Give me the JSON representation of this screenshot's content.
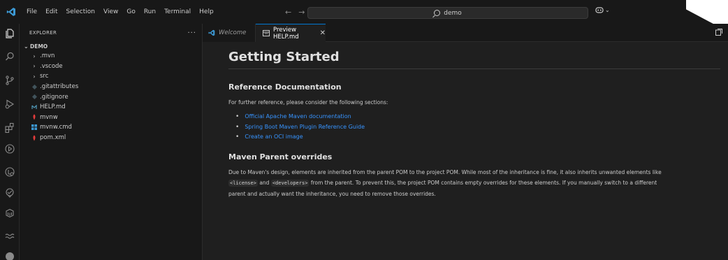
{
  "titlebar": {
    "menu": [
      "File",
      "Edit",
      "Selection",
      "View",
      "Go",
      "Run",
      "Terminal",
      "Help"
    ],
    "search_text": "demo"
  },
  "sidebar": {
    "title": "EXPLORER",
    "more": "···",
    "root": "DEMO",
    "items": [
      {
        "label": ".mvn",
        "type": "folder"
      },
      {
        "label": ".vscode",
        "type": "folder"
      },
      {
        "label": "src",
        "type": "folder"
      },
      {
        "label": ".gitattributes",
        "type": "git"
      },
      {
        "label": ".gitignore",
        "type": "git"
      },
      {
        "label": "HELP.md",
        "type": "markdown"
      },
      {
        "label": "mvnw",
        "type": "maven"
      },
      {
        "label": "mvnw.cmd",
        "type": "windows"
      },
      {
        "label": "pom.xml",
        "type": "maven"
      }
    ]
  },
  "tabs": {
    "welcome": "Welcome",
    "preview": "Preview HELP.md"
  },
  "doc": {
    "title": "Getting Started",
    "section1_title": "Reference Documentation",
    "section1_intro": "For further reference, please consider the following sections:",
    "links": [
      "Official Apache Maven documentation",
      "Spring Boot Maven Plugin Reference Guide",
      "Create an OCI image"
    ],
    "section2_title": "Maven Parent overrides",
    "p_part1": "Due to Maven's design, elements are inherited from the parent POM to the project POM. While most of the inheritance is fine, it also inherits unwanted elements like",
    "code_license": "<license>",
    "p_and": "and",
    "code_developers": "<developers>",
    "p_part2": "from the parent. To prevent this, the project POM contains empty overrides for these elements. If you manually switch to a different",
    "p_part3": "parent and actually want the inheritance, you need to remove those overrides."
  },
  "colors": {
    "accent": "#0078d4",
    "link": "#3794ff",
    "vscode_blue": "#3c99d4"
  }
}
